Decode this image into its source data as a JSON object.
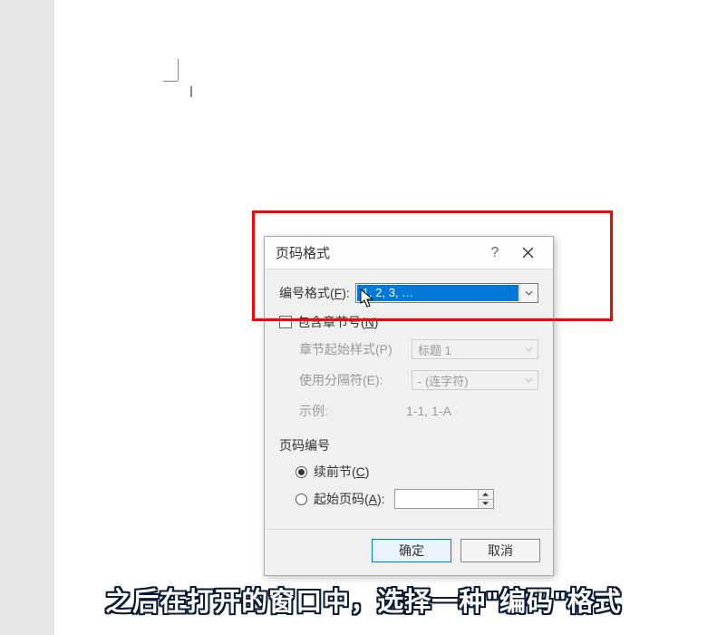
{
  "dialog": {
    "title": "页码格式",
    "help": "?",
    "number_format_label": "编号格式(",
    "number_format_hotkey": "F",
    "number_format_suffix": "):",
    "number_format_value": "1, 2, 3, …",
    "include_chapter_label": "包含章节号(",
    "include_chapter_hotkey": "N",
    "include_chapter_suffix": ")",
    "chapter_start_label": "章节起始样式(P)",
    "chapter_start_value": "标题 1",
    "separator_label": "使用分隔符(E):",
    "separator_value": "-  (连字符)",
    "example_label": "示例:",
    "example_value": "1-1, 1-A",
    "page_numbering_title": "页码编号",
    "continue_label": "续前节(",
    "continue_hotkey": "C",
    "continue_suffix": ")",
    "start_at_label": "起始页码(",
    "start_at_hotkey": "A",
    "start_at_suffix": "):",
    "start_at_value": "",
    "ok": "确定",
    "cancel": "取消"
  },
  "subtitle": "之后在打开的窗口中，选择一种\"编码\"格式"
}
